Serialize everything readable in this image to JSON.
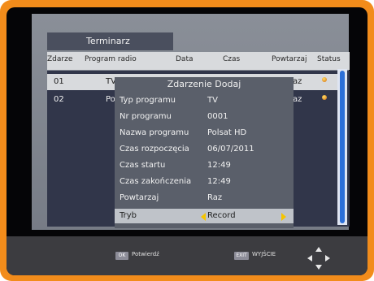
{
  "window": {
    "title": "Terminarz"
  },
  "table": {
    "columns": [
      "Zdarze",
      "Program radio",
      "Data",
      "Czas",
      "Powtarzaj",
      "Status"
    ],
    "rows": [
      {
        "index": "01",
        "channel": "TV",
        "repeat": "az",
        "selected": true
      },
      {
        "index": "02",
        "channel": "Pol",
        "repeat": "az",
        "selected": false
      }
    ]
  },
  "dialog": {
    "title": "Zdarzenie Dodaj",
    "fields": [
      {
        "label": "Typ programu",
        "value": "TV"
      },
      {
        "label": "Nr programu",
        "value": "0001"
      },
      {
        "label": "Nazwa programu",
        "value": "Polsat HD"
      },
      {
        "label": "Czas rozpoczęcia",
        "value": "06/07/2011"
      },
      {
        "label": "Czas startu",
        "value": "12:49"
      },
      {
        "label": "Czas zakończenia",
        "value": "12:49"
      },
      {
        "label": "Powtarzaj",
        "value": "Raz"
      },
      {
        "label": "Tryb",
        "value": "Record"
      }
    ]
  },
  "footer": {
    "ok_key": "OK",
    "ok_label": "Potwierdź",
    "exit_key": "EXIT",
    "exit_label": "WYJŚCIE"
  },
  "colors": {
    "frame": "#f28c1b",
    "selection": "#d8dadd",
    "accent": "#f5c400"
  }
}
